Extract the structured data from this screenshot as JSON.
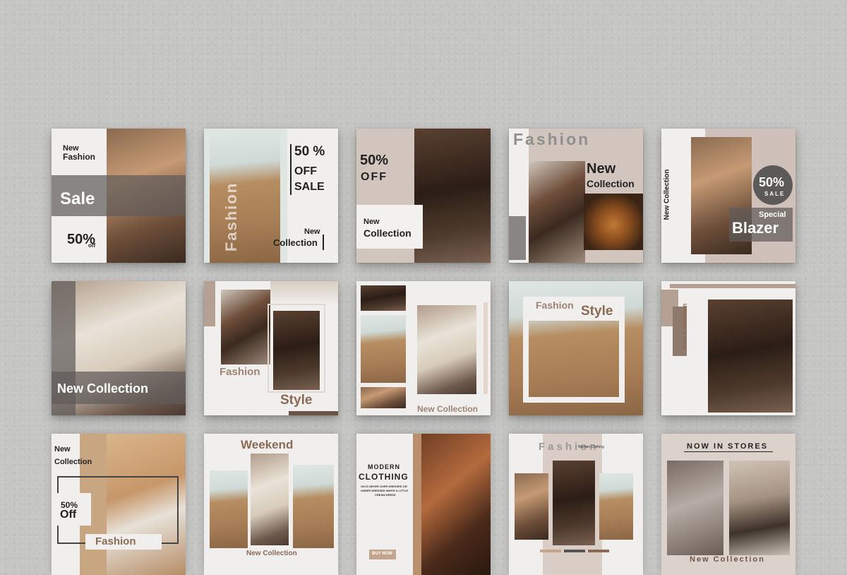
{
  "colors": {
    "background": "#c5c5c3",
    "card": "#f1efed",
    "accent_brown": "#8b6a55",
    "taupe": "#cdbfb7",
    "dark_gray": "#5f5c5a"
  },
  "templates": [
    {
      "id": 1,
      "texts": [
        "New",
        "Fashion",
        "Sale",
        "50%",
        "off"
      ]
    },
    {
      "id": 2,
      "texts": [
        "50 %",
        "OFF",
        "SALE",
        "New",
        "Collection",
        "Fashion"
      ]
    },
    {
      "id": 3,
      "texts": [
        "50%",
        "OFF",
        "New",
        "Collection"
      ]
    },
    {
      "id": 4,
      "texts": [
        "Fashion",
        "New",
        "Collection"
      ]
    },
    {
      "id": 5,
      "texts": [
        "New Collection",
        "50%",
        "SALE",
        "Special",
        "Blazer"
      ]
    },
    {
      "id": 6,
      "texts": [
        "New Collection"
      ]
    },
    {
      "id": 7,
      "texts": [
        "Fashion",
        "Style"
      ]
    },
    {
      "id": 8,
      "texts": [
        "New Collection"
      ]
    },
    {
      "id": 9,
      "texts": [
        "Fashion",
        "Style"
      ]
    },
    {
      "id": 10,
      "texts": [
        "New Collection"
      ]
    },
    {
      "id": 11,
      "texts": [
        "New",
        "Collection",
        "50%",
        "Off",
        "Fashion"
      ]
    },
    {
      "id": 12,
      "texts": [
        "Weekend",
        "New Collection"
      ]
    },
    {
      "id": 13,
      "texts": [
        "MODERN",
        "CLOTHING",
        "ON IS NEVER OVER DRESSED OR",
        "UNDER DRESSED WHITE A LITTLE",
        "CREAM DRESS",
        "BUY NOW"
      ]
    },
    {
      "id": 14,
      "texts": [
        "Fashion",
        "Women Clothing"
      ]
    },
    {
      "id": 15,
      "texts": [
        "NOW IN STORES",
        "New Collection"
      ]
    }
  ]
}
